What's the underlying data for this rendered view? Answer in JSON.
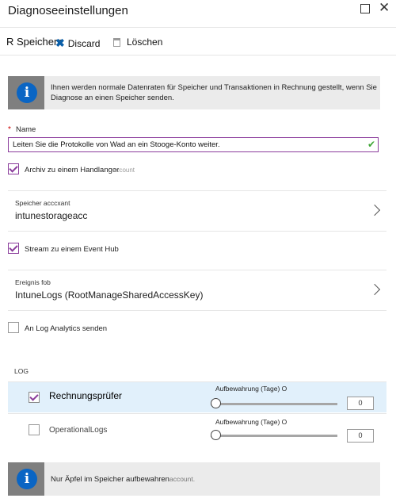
{
  "window": {
    "title": "Diagnoseeinstellungen",
    "close_glyph": "✕",
    "maximize_icon": "maximize-icon"
  },
  "toolbar": {
    "save_label": "R Speichern",
    "discard_icon": "discard-x-icon",
    "discard_label": "Discard",
    "delete_icon": "trash-icon",
    "delete_label": "Löschen"
  },
  "info_top": {
    "icon": "info-icon",
    "text_line1": "Ihnen werden normale Datenraten für Speicher und Transaktionen in Rechnung gestellt, wenn Sie",
    "text_line2": "Diagnose an einen Speicher senden."
  },
  "name_field": {
    "required_mark": "*",
    "label": "Name",
    "value": "Leiten Sie die Protokolle von Wad an ein Stooge-Konto weiter.",
    "valid_glyph": "✔"
  },
  "archive": {
    "checked": true,
    "label": "Archiv zu einem Handlanger",
    "ghost_text": "account"
  },
  "storage": {
    "small_label": "Speicher acccxant",
    "value": "intunestorageacc"
  },
  "event_hub": {
    "checked": true,
    "label": "Stream zu einem Event Hub"
  },
  "event_ns": {
    "small_label": "Ereignis fob",
    "value": "IntuneLogs (RootManageSharedAccessKey)"
  },
  "log_analytics": {
    "checked": false,
    "label": "An Log Analytics senden"
  },
  "log_section": {
    "heading": "LOG",
    "rows": [
      {
        "name": "Rechnungsprüfer",
        "checked": true,
        "selected": true,
        "retention_label": "Aufbewahrung (Tage) O",
        "days": "0"
      },
      {
        "name": "OperationalLogs",
        "checked": false,
        "selected": false,
        "retention_label": "Aufbewahrung (Tage) O",
        "days": "0"
      }
    ]
  },
  "info_bottom": {
    "icon": "info-icon",
    "text": "Nur Äpfel im Speicher aufbewahren",
    "ghost_text": "account."
  },
  "colors": {
    "accent": "#8b3d9c",
    "info_blue": "#0a65c4",
    "selected_row": "#e1f0fb",
    "valid_green": "#3fa535"
  }
}
